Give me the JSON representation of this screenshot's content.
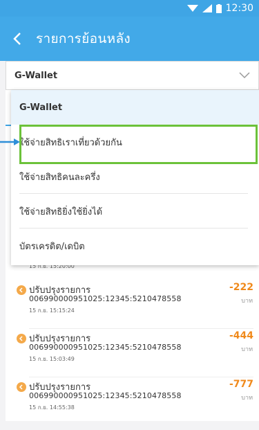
{
  "status_bar": {
    "time": "12:30"
  },
  "header": {
    "title": "รายการย้อนหลัง"
  },
  "select": {
    "value": "G-Wallet"
  },
  "dropdown": {
    "items": [
      {
        "label": "G-Wallet",
        "selected": true
      },
      {
        "label": "ใช้จ่ายสิทธิเราเที่ยวด้วยกัน",
        "selected": false
      },
      {
        "label": "ใช้จ่ายสิทธิคนละครึ่ง",
        "selected": false
      },
      {
        "label": "ใช้จ่ายสิทธิยิ่งใช้ยิ่งได้",
        "selected": false
      },
      {
        "label": "บัตรเครดิต/เดบิต",
        "selected": false
      }
    ]
  },
  "partial_row_time": "15 ก.ย. 15:20:00",
  "transactions": [
    {
      "title": "ปรับปรุงรายการ",
      "ref": "006990000951025:12345:5210478558",
      "time": "15 ก.ย. 15:15:24",
      "amount": "-222",
      "unit": "บาท"
    },
    {
      "title": "ปรับปรุงรายการ",
      "ref": "006990000951025:12345:5210478558",
      "time": "15 ก.ย. 15:03:49",
      "amount": "-444",
      "unit": "บาท"
    },
    {
      "title": "ปรับปรุงรายการ",
      "ref": "006990000951025:12345:5210478558",
      "time": "15 ก.ย. 14:55:38",
      "amount": "-777",
      "unit": "บาท"
    }
  ],
  "colors": {
    "header": "#42a9e8",
    "amount": "#f08a1c",
    "highlight": "#6cc23a",
    "arrow": "#2f8fd8"
  },
  "icons": {
    "back": "chevron-left-icon",
    "dropdown": "chevron-down-icon",
    "txn": "arrow-left-circle-icon"
  }
}
